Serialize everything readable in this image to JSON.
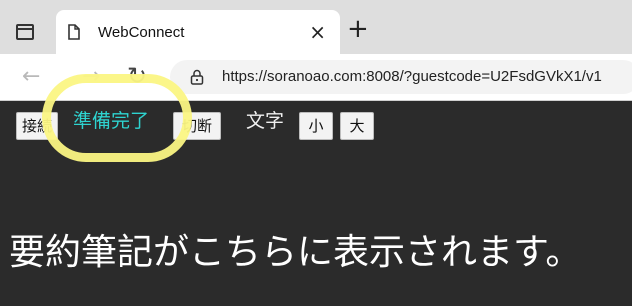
{
  "browser": {
    "tab_title": "WebConnect",
    "tab_close": "×",
    "new_tab": "+",
    "url": "https://soranoao.com:8008/?guestcode=U2FsdGVkX1/v1"
  },
  "nav": {
    "back": "←",
    "forward": "→",
    "reload": "↻"
  },
  "controls": {
    "connect_label": "接続",
    "status_text": "準備完了",
    "disconnect_label": "切断",
    "font_size_label": "文字",
    "small_label": "小",
    "large_label": "大"
  },
  "caption": {
    "text": "要約筆記がこちらに表示されます。"
  },
  "colors": {
    "page_background": "#2b2b2b",
    "status_text": "#2ed3d0",
    "highlight_circle": "#fbf583"
  }
}
